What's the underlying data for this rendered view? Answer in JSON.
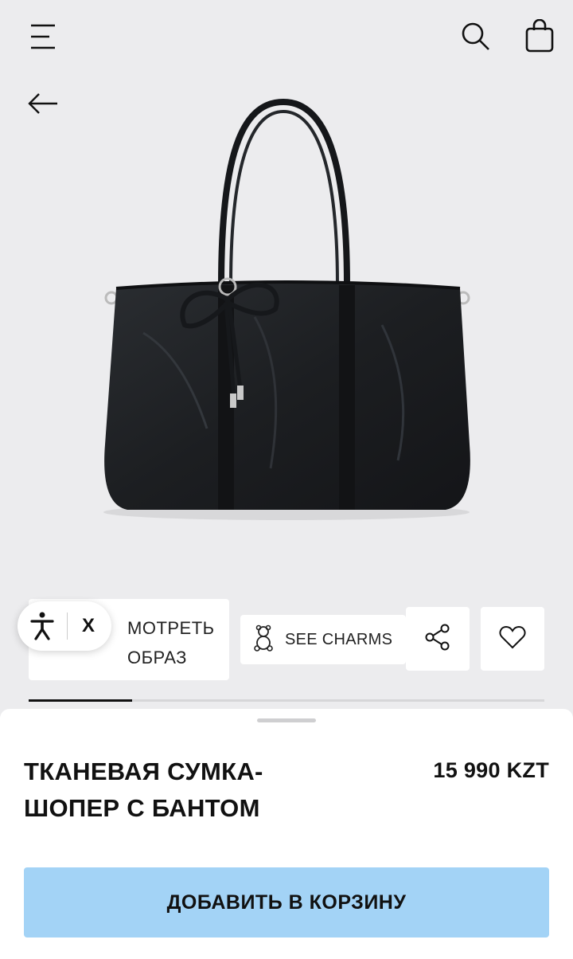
{
  "header": {
    "menu_icon": "hamburger-menu-icon",
    "search_icon": "search-icon",
    "bag_icon": "shopping-bag-icon",
    "back_icon": "arrow-left-icon"
  },
  "product": {
    "image_alt": "black-nylon-tote-bag-with-bow",
    "name_line1": "ТКАНЕВАЯ СУМКА-",
    "name_line2": "ШОПЕР С БАНТОМ",
    "price": "15 990 KZT"
  },
  "actions": {
    "look_line1": "МОТРЕТЬ",
    "look_line2": "ОБРАЗ",
    "charms_label": "SEE CHARMS",
    "accessibility_close": "X",
    "share_icon": "share-icon",
    "favorite_icon": "heart-icon"
  },
  "gallery": {
    "progress": 0.2
  },
  "cart": {
    "add_label": "ДОБАВИТЬ В КОРЗИНУ",
    "button_color": "#a3d3f6"
  }
}
